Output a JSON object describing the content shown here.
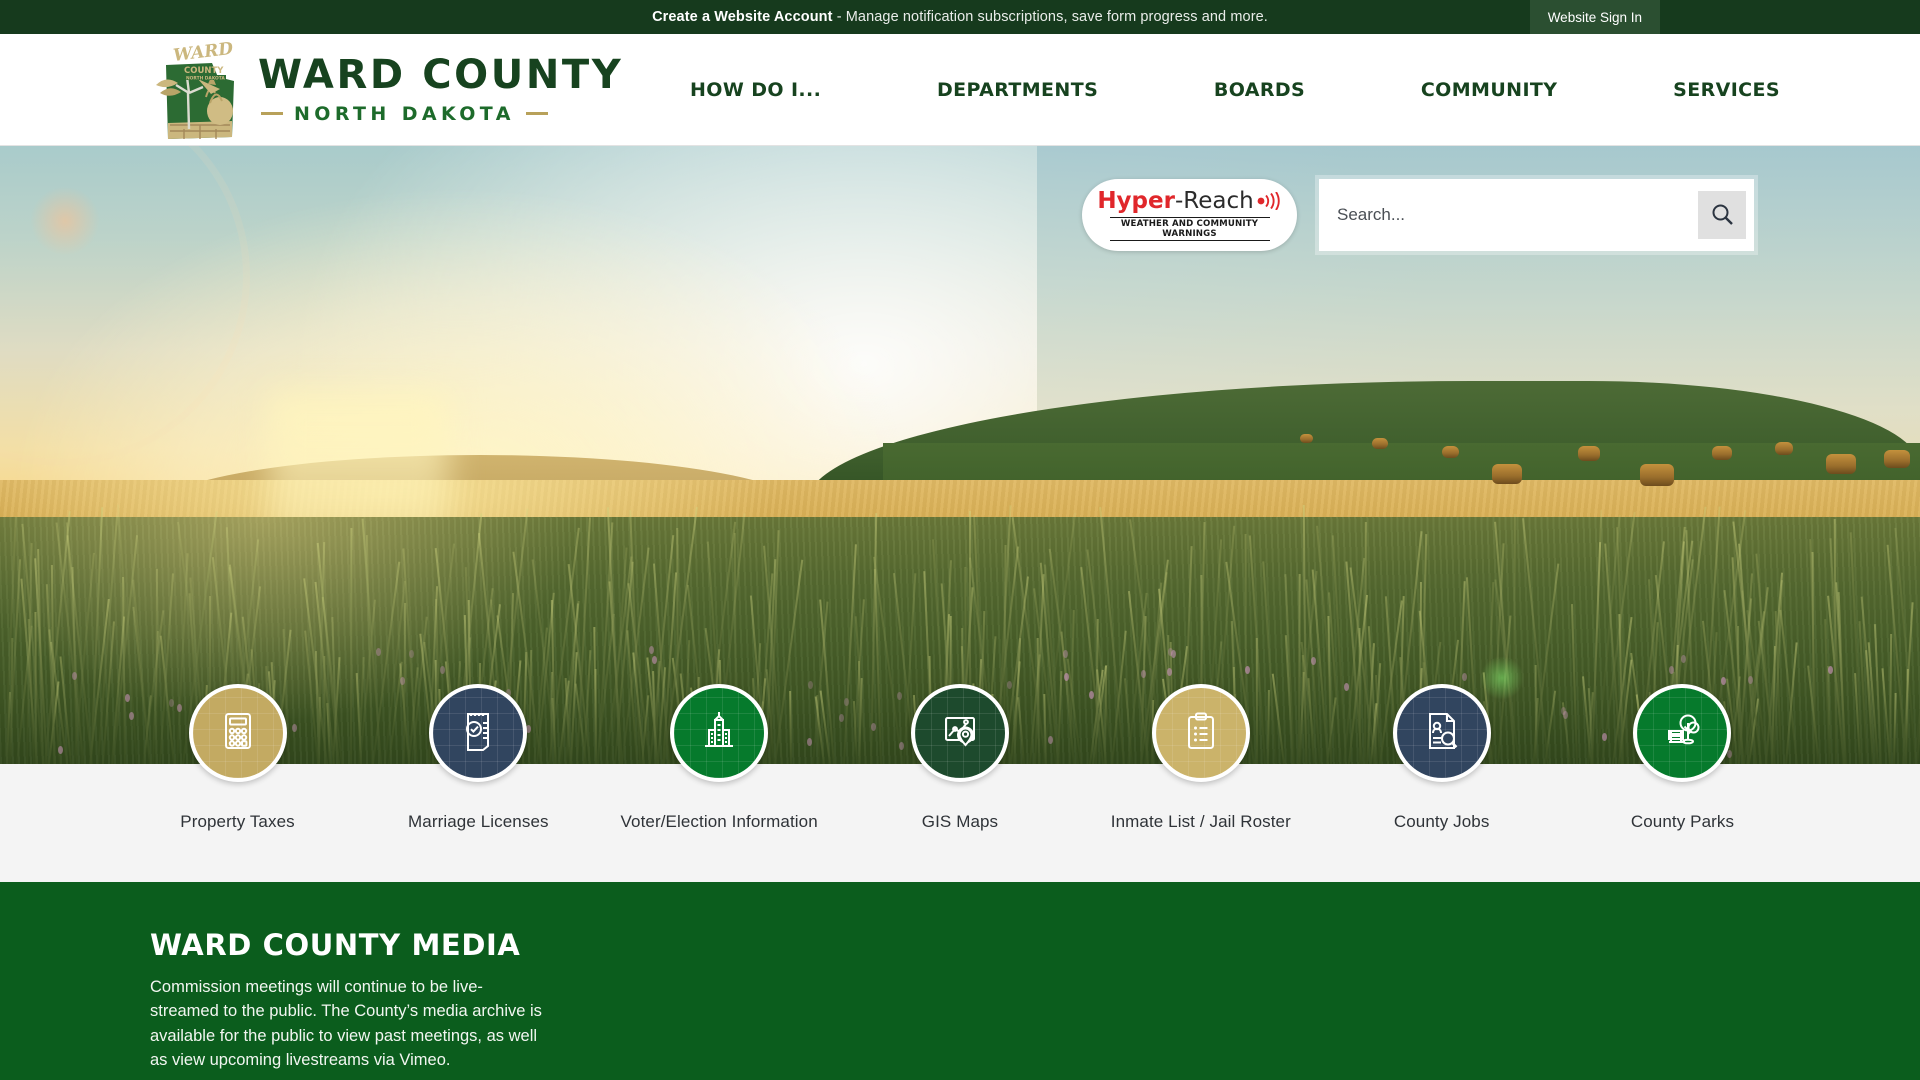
{
  "topbar": {
    "account_link": "Create a Website Account",
    "account_rest": " - Manage notification subscriptions, save form progress and more.",
    "signin_label": "Website Sign In"
  },
  "header": {
    "brand_title": "WARD COUNTY",
    "brand_subtitle": "NORTH DAKOTA",
    "logo_alt": "ward-county-seal",
    "nav": [
      {
        "label": "HOW DO I..."
      },
      {
        "label": "DEPARTMENTS"
      },
      {
        "label": "BOARDS"
      },
      {
        "label": "COMMUNITY"
      },
      {
        "label": "SERVICES"
      }
    ]
  },
  "hero": {
    "hyper_reach": {
      "name_bold": "Hyper",
      "name_rest": "-Reach",
      "tagline": "WEATHER AND COMMUNITY WARNINGS"
    },
    "search": {
      "placeholder": "Search...",
      "value": "",
      "button_icon": "search-icon"
    }
  },
  "quicklinks": [
    {
      "label": "Property Taxes",
      "icon": "calculator-icon",
      "color": "#c3aa62"
    },
    {
      "label": "Marriage Licenses",
      "icon": "document-check-icon",
      "color": "#31455f"
    },
    {
      "label": "Voter/Election Information",
      "icon": "capitol-building-icon",
      "color": "#067a2c"
    },
    {
      "label": "GIS Maps",
      "icon": "map-pin-icon",
      "color": "#1d4a2d"
    },
    {
      "label": "Inmate List / Jail Roster",
      "icon": "clipboard-icon",
      "color": "#cbb36a"
    },
    {
      "label": "County Jobs",
      "icon": "resume-search-icon",
      "color": "#31455f"
    },
    {
      "label": "County Parks",
      "icon": "park-bench-tree-icon",
      "color": "#067a2c"
    }
  ],
  "media": {
    "title": "WARD COUNTY MEDIA",
    "body": "Commission meetings will continue to be live-streamed to the public. The County’s media archive is available for the public to view past meetings, as well as view upcoming livestreams via Vimeo."
  },
  "colors": {
    "topbar_green": "#163a1d",
    "brand_green": "#17431f",
    "media_green": "#0b5d1d",
    "accent_gold": "#b8a15a",
    "quicklinks_band": "#f4f4f4"
  }
}
